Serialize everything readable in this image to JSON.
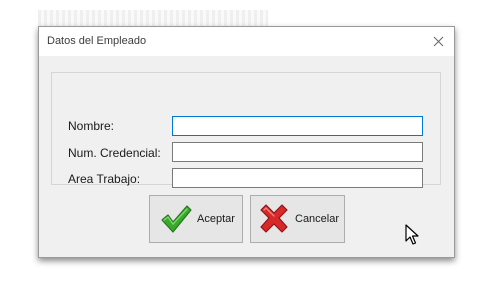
{
  "window": {
    "title": "Datos del Empleado",
    "close_icon": "close-icon"
  },
  "form": {
    "fields": [
      {
        "label": "Nombre:",
        "value": "",
        "focused": true
      },
      {
        "label": "Num. Credencial:",
        "value": ""
      },
      {
        "label": "Area Trabajo:",
        "value": ""
      }
    ]
  },
  "buttons": {
    "accept": {
      "label": "Aceptar",
      "icon": "checkmark-icon",
      "color": "#3aa82b"
    },
    "cancel": {
      "label": "Cancelar",
      "icon": "red-x-icon",
      "color": "#d7282a"
    }
  }
}
